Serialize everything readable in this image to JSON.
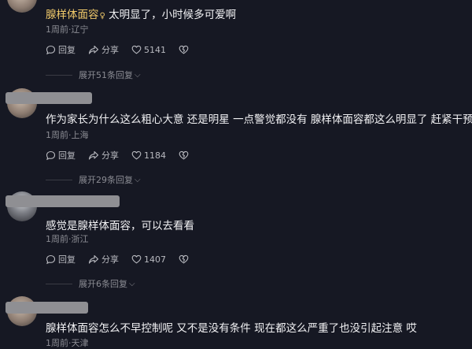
{
  "comments": [
    {
      "username": "腺样体面容",
      "badge": "♀",
      "text": "太明显了，小时候多可爱啊",
      "meta": "1周前·辽宁",
      "reply_label": "回复",
      "share_label": "分享",
      "likes": "5141",
      "replies_label": "展开51条回复"
    },
    {
      "username": "",
      "text": "作为家长为什么这么粗心大意 还是明星 一点警觉都没有 腺样体面容都这么明显了 赶紧干预吧",
      "meta": "1周前·上海",
      "reply_label": "回复",
      "share_label": "分享",
      "likes": "1184",
      "replies_label": "展开29条回复"
    },
    {
      "username": "",
      "text": "感觉是腺样体面容，可以去看看",
      "meta": "1周前·浙江",
      "reply_label": "回复",
      "share_label": "分享",
      "likes": "1407",
      "replies_label": "展开6条回复"
    },
    {
      "username": "",
      "text": "腺样体面容怎么不早控制呢 又不是没有条件 现在都这么严重了也没引起注意 哎",
      "meta": "1周前·天津"
    }
  ],
  "icons": {
    "reply": "comment-bubble-icon",
    "share": "share-arrow-icon",
    "like": "heart-outline-icon",
    "dislike": "broken-heart-icon",
    "expand": "chevron-down-icon"
  },
  "colors": {
    "background": "#161823",
    "username": "#f0c96a",
    "text": "#f2f2f4",
    "meta": "#8b8c93"
  }
}
